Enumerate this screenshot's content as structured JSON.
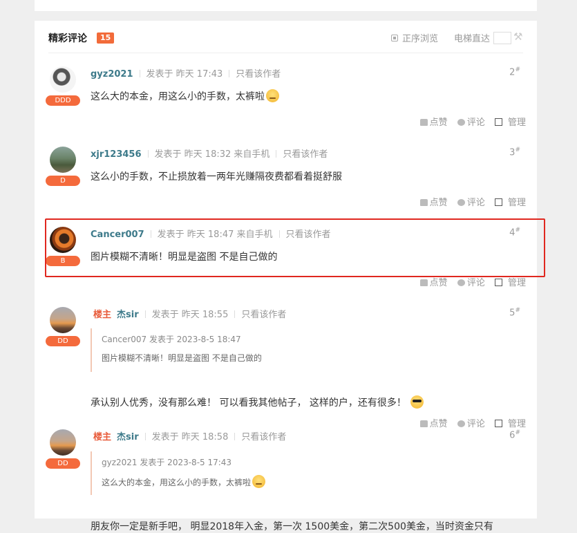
{
  "header": {
    "title": "精彩评论",
    "count": "15",
    "order_label": "正序浏览",
    "elevator_label": "电梯直达"
  },
  "posts": [
    {
      "username": "gyz2021",
      "posted": "发表于 昨天 17:43",
      "author_only": "只看该作者",
      "floor": "2",
      "badge": "DDD",
      "text": "这么大的本金，用这么小的手数，太裤啦"
    },
    {
      "username": "xjr123456",
      "posted": "发表于 昨天 18:32 来自手机",
      "author_only": "只看该作者",
      "floor": "3",
      "badge": "D",
      "text": "这么小的手数，不止损放着一两年光赚隔夜费都看着挺舒服"
    },
    {
      "username": "Cancer007",
      "posted": "发表于 昨天 18:47 来自手机",
      "author_only": "只看该作者",
      "floor": "4",
      "badge": "B",
      "text": "图片模糊不清晰！明显是盗图 不是自己做的"
    },
    {
      "lz_label": "楼主",
      "username": "杰sir",
      "posted": "发表于 昨天 18:55",
      "author_only": "只看该作者",
      "floor": "5",
      "badge": "DD",
      "quote_meta": "Cancer007 发表于 2023-8-5 18:47",
      "quote_text": "图片模糊不清晰！明显是盗图 不是自己做的",
      "text": "承认别人优秀，没有那么难！ 可以看我其他帖子， 这样的户，还有很多！"
    },
    {
      "lz_label": "楼主",
      "username": "杰sir",
      "posted": "发表于 昨天 18:58",
      "author_only": "只看该作者",
      "floor": "6",
      "badge": "DD",
      "quote_meta": "gyz2021 发表于 2023-8-5 17:43",
      "quote_text": "这么大的本金，用这么小的手数，太裤啦",
      "text": "朋友你一定是新手吧， 明显2018年入金，第一次 1500美金，第二次500美金，当时资金只有"
    }
  ],
  "actions": {
    "like": "点赞",
    "comment": "评论",
    "manage": "管理"
  },
  "floor_mark": "#"
}
